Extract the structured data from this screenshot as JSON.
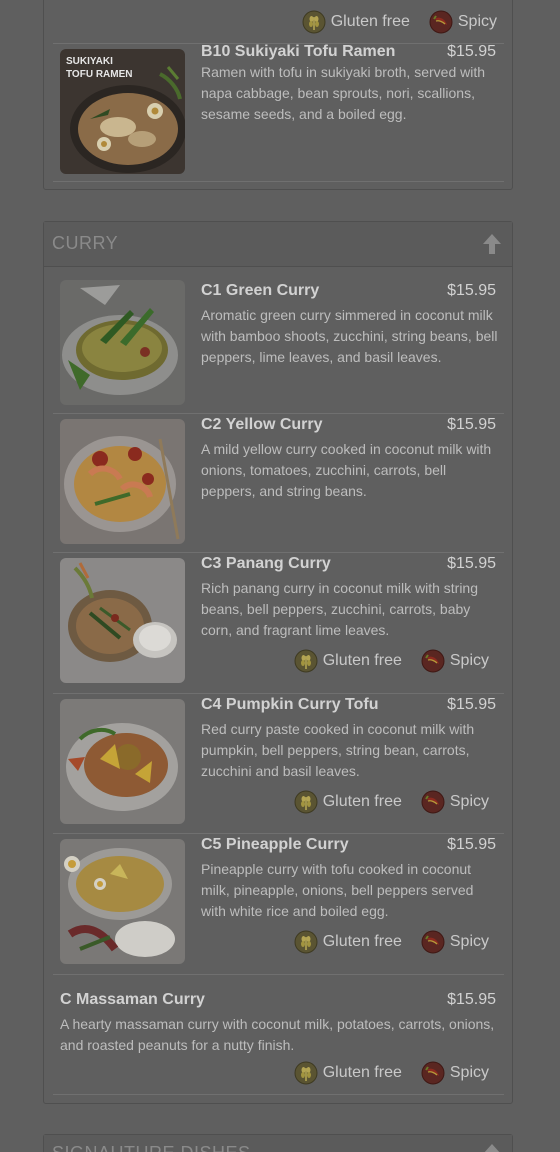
{
  "tag_labels": {
    "gluten_free": "Gluten free",
    "spicy": "Spicy"
  },
  "top_section": {
    "item": {
      "name": "B10 Sukiyaki Tofu Ramen",
      "price": "$15.95",
      "description": "Ramen with tofu in sukiyaki broth, served with napa cabbage, bean sprouts, nori, scallions, sesame seeds, and a boiled egg.",
      "image_text": [
        "SUKIYAKI",
        "TOFU RAMEN"
      ]
    }
  },
  "curry_section": {
    "title": "CURRY",
    "items": [
      {
        "name": "C1 Green Curry",
        "price": "$15.95",
        "description": "Aromatic green curry simmered in coconut milk with bamboo shoots, zucchini, string beans, bell peppers, lime leaves, and basil leaves."
      },
      {
        "name": "C2 Yellow Curry",
        "price": "$15.95",
        "description": "A mild yellow curry cooked in coconut milk with onions, tomatoes, zucchini, carrots, bell peppers, and string beans."
      },
      {
        "name": "C3 Panang Curry",
        "price": "$15.95",
        "description": "Rich panang curry in coconut milk with string beans, bell peppers, zucchini, carrots, baby corn, and fragrant lime leaves."
      },
      {
        "name": "C4 Pumpkin Curry Tofu",
        "price": "$15.95",
        "description": "Red curry paste cooked in coconut milk with pumpkin, bell peppers, string bean, carrots, zucchini and basil leaves."
      },
      {
        "name": "C5 Pineapple Curry",
        "price": "$15.95",
        "description": "Pineapple curry with tofu cooked in coconut milk, pineapple, onions, bell peppers served with white rice and boiled egg."
      },
      {
        "name": "C Massaman Curry",
        "price": "$15.95",
        "description": "A hearty massaman curry with coconut milk, potatoes, carrots, onions, and roasted peanuts for a nutty finish."
      }
    ]
  },
  "signature_section": {
    "title": "SIGNAUTURE DISHES"
  },
  "colors": {
    "overlay_bg": "#5f5f5f",
    "spicy_icon": "#7a1e1a",
    "gluten_icon": "#8a7d3a"
  }
}
